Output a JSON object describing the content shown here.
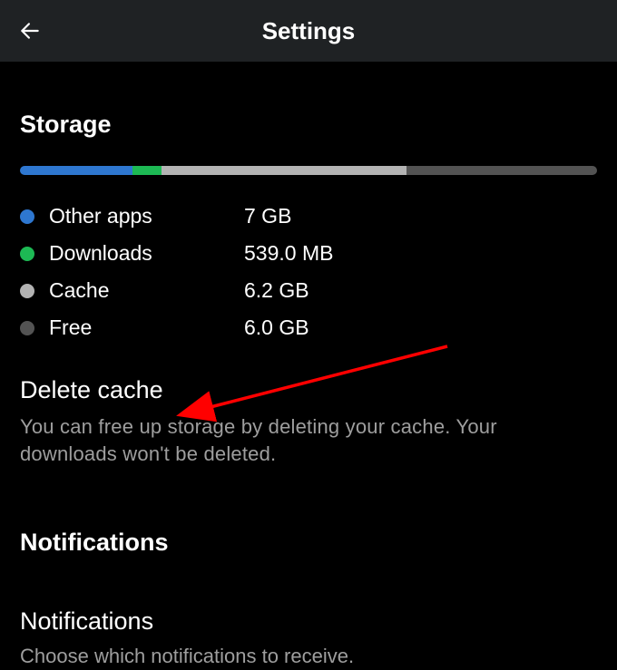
{
  "header": {
    "title": "Settings"
  },
  "storage": {
    "heading": "Storage",
    "bar": {
      "segments": [
        {
          "name": "other-apps",
          "color": "#2e77d0",
          "width_pct": 19.5
        },
        {
          "name": "downloads",
          "color": "#1db954",
          "width_pct": 5
        },
        {
          "name": "cache",
          "color": "#b3b3b3",
          "width_pct": 42.5
        },
        {
          "name": "free",
          "color": "#535353",
          "width_pct": 33
        }
      ]
    },
    "legend": [
      {
        "label": "Other apps",
        "value": "7 GB",
        "color": "#2e77d0"
      },
      {
        "label": "Downloads",
        "value": "539.0 MB",
        "color": "#1db954"
      },
      {
        "label": "Cache",
        "value": "6.2 GB",
        "color": "#b3b3b3"
      },
      {
        "label": "Free",
        "value": "6.0 GB",
        "color": "#535353"
      }
    ],
    "delete": {
      "title": "Delete cache",
      "desc": "You can free up storage by deleting your cache. Your downloads won't be deleted."
    }
  },
  "notifications": {
    "heading": "Notifications",
    "item": {
      "title": "Notifications",
      "desc": "Choose which notifications to receive."
    }
  },
  "annotation": {
    "arrow_color": "#ff0000"
  }
}
